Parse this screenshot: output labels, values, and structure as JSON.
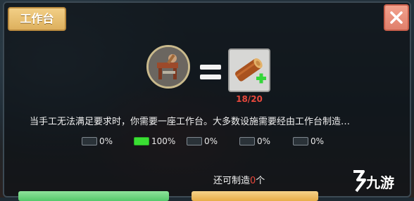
{
  "window": {
    "title": "工作台"
  },
  "recipe": {
    "ingredient_icon": "crafting-bench-icon",
    "product_icon": "wood-log-icon",
    "product_count": "18/20"
  },
  "description": "当手工无法满足要求时，你需要一座工作台。大多数设施需要经由工作台制造…",
  "progress_slots": [
    {
      "label": "0%",
      "value": 0
    },
    {
      "label": "100%",
      "value": 1
    },
    {
      "label": "0%",
      "value": 0
    },
    {
      "label": "0%",
      "value": 0
    },
    {
      "label": "0%",
      "value": 0
    }
  ],
  "craft": {
    "remaining_prefix": "还可制造",
    "remaining_count": "0",
    "remaining_suffix": "个"
  },
  "watermark": "九游",
  "colors": {
    "title_tab": "#e8bf70",
    "close_button": "#e8907b",
    "progress_on": "#3adf33",
    "count_red": "#e7483c"
  }
}
